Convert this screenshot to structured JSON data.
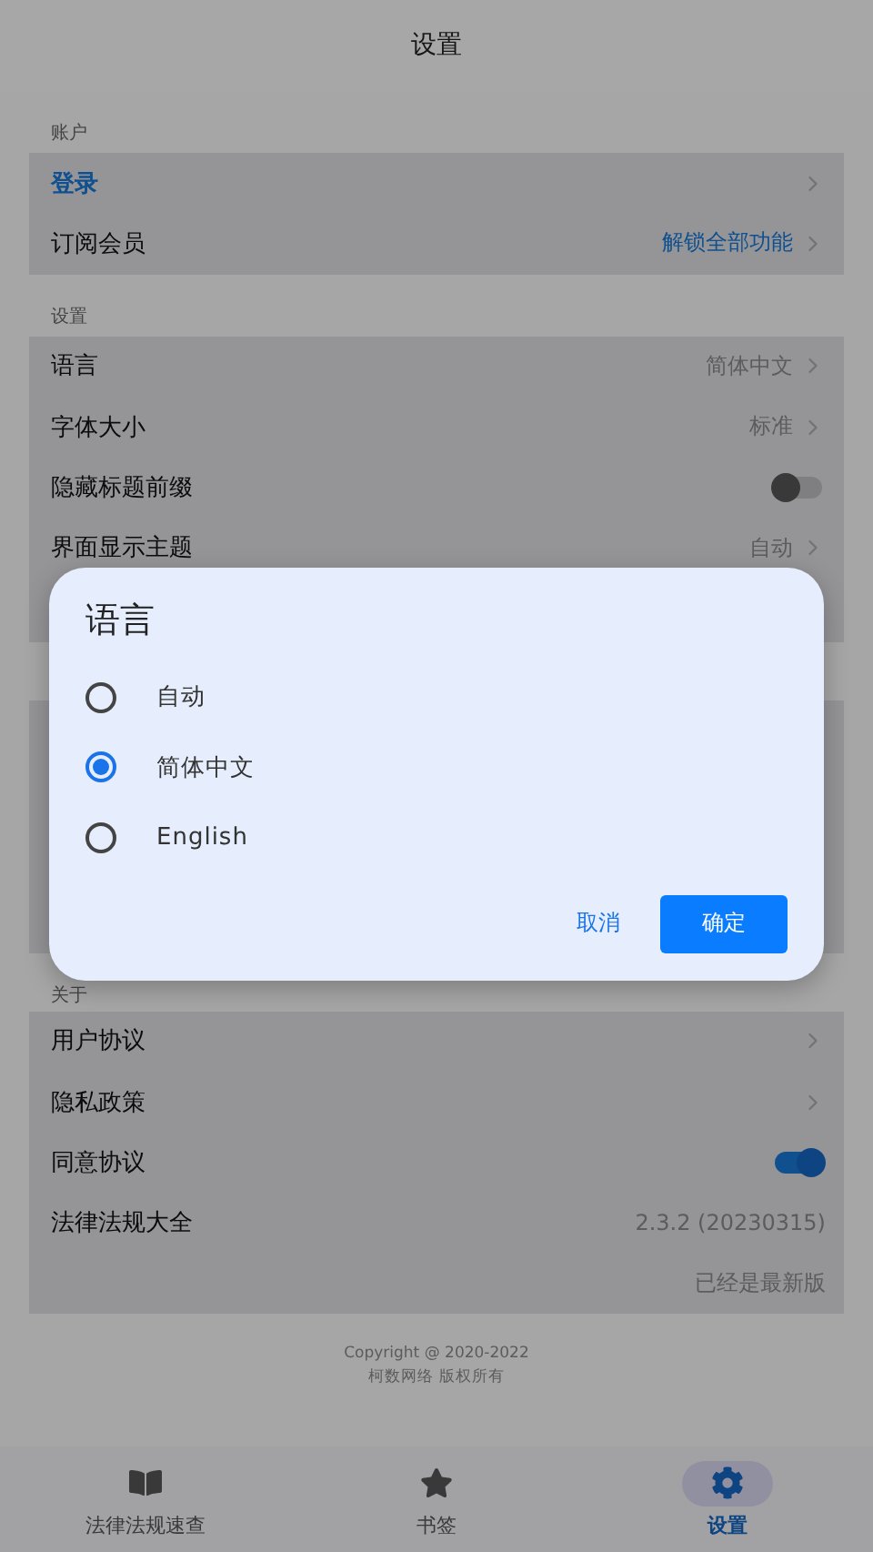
{
  "header": {
    "title": "设置"
  },
  "sections": [
    {
      "label": "账户",
      "rows": [
        {
          "kind": "link",
          "label": "登录",
          "label_is_link": true
        },
        {
          "kind": "link",
          "label": "订阅会员",
          "value": "解锁全部功能",
          "value_is_link": true
        }
      ]
    },
    {
      "label": "设置",
      "rows": [
        {
          "kind": "link",
          "label": "语言",
          "value": "简体中文"
        },
        {
          "kind": "link",
          "label": "字体大小",
          "value": "标准"
        },
        {
          "kind": "toggle",
          "label": "隐藏标题前缀",
          "on": false
        },
        {
          "kind": "link",
          "label": "界面显示主题",
          "value": "自动"
        }
      ]
    },
    {
      "label": "关于",
      "rows": [
        {
          "kind": "link",
          "label": "用户协议"
        },
        {
          "kind": "link",
          "label": "隐私政策"
        },
        {
          "kind": "toggle",
          "label": "同意协议",
          "on": true
        },
        {
          "kind": "info",
          "label": "法律法规大全",
          "value": "2.3.2 (20230315)"
        },
        {
          "kind": "note",
          "value": "已经是最新版"
        }
      ]
    }
  ],
  "copyright": [
    "Copyright @ 2020-2022",
    "柯数网络 版权所有"
  ],
  "nav": [
    {
      "label": "法律法规速查",
      "selected": false
    },
    {
      "label": "书签",
      "selected": false
    },
    {
      "label": "设置",
      "selected": true
    }
  ],
  "dialog": {
    "title": "语言",
    "options": [
      {
        "label": "自动",
        "selected": false
      },
      {
        "label": "简体中文",
        "selected": true
      },
      {
        "label": "English",
        "selected": false
      }
    ],
    "cancel": "取消",
    "confirm": "确定"
  }
}
